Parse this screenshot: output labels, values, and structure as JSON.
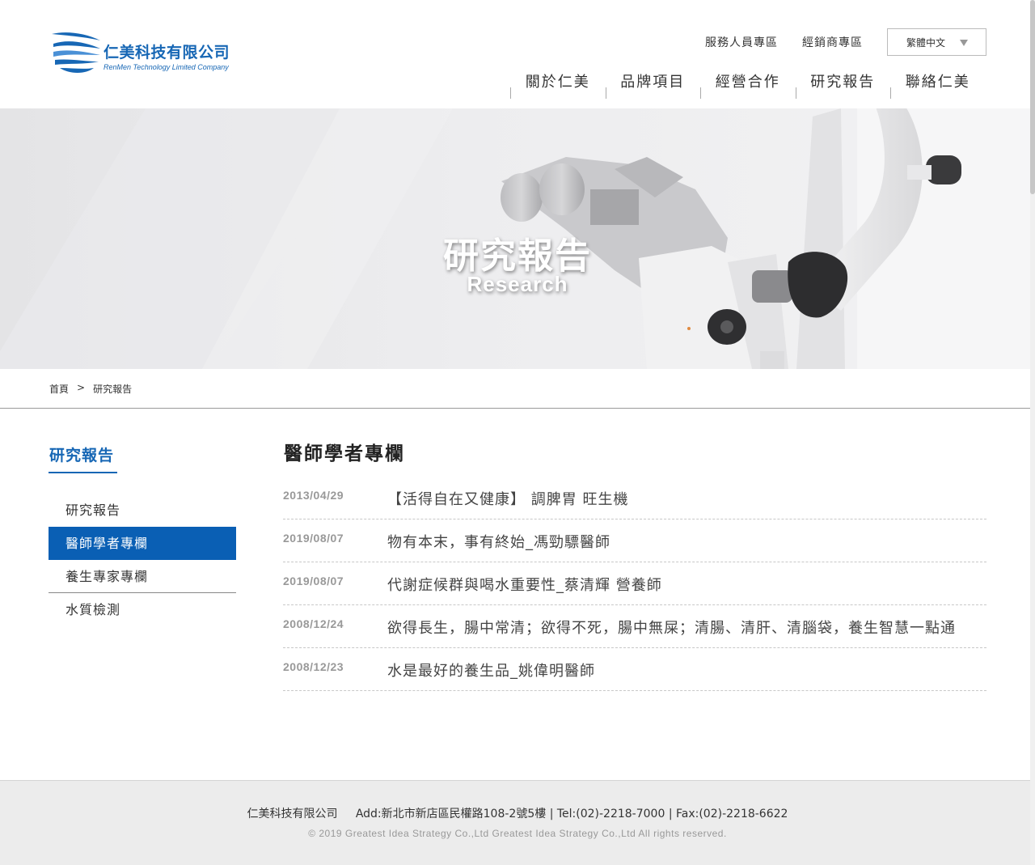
{
  "header": {
    "logo_name": "仁美科技有限公司",
    "logo_sub": "RenMen Technology Limited Company",
    "top_links": [
      "服務人員專區",
      "經銷商專區"
    ],
    "language": "繁體中文",
    "nav": [
      "關於仁美",
      "品牌項目",
      "經營合作",
      "研究報告",
      "聯絡仁美"
    ]
  },
  "banner": {
    "title": "研究報告",
    "subtitle": "Research"
  },
  "breadcrumb": {
    "home": "首頁",
    "separator": ">",
    "current": "研究報告"
  },
  "sidebar": {
    "title": "研究報告",
    "items": [
      "研究報告",
      "醫師學者專欄",
      "養生專家專欄",
      "水質檢測"
    ],
    "active_index": 1
  },
  "content": {
    "title": "醫師學者專欄",
    "articles": [
      {
        "date": "2013/04/29",
        "title": "【活得自在又健康】 調脾胃 旺生機"
      },
      {
        "date": "2019/08/07",
        "title": "物有本末，事有終始_馮勁驃醫師"
      },
      {
        "date": "2019/08/07",
        "title": "代謝症候群與喝水重要性_蔡清輝 營養師"
      },
      {
        "date": "2008/12/24",
        "title": "欲得長生，腸中常清；欲得不死，腸中無屎；清腸、清肝、清腦袋，養生智慧一點通"
      },
      {
        "date": "2008/12/23",
        "title": "水是最好的養生品_姚偉明醫師"
      }
    ]
  },
  "footer": {
    "company": "仁美科技有限公司",
    "address": "Add:新北市新店區民權路108-2號5樓",
    "tel": "Tel:(02)-2218-7000",
    "fax": "Fax:(02)-2218-6622",
    "copyright": "© 2019 Greatest Idea Strategy Co.,Ltd Greatest Idea Strategy Co.,Ltd All rights reserved."
  },
  "colors": {
    "brand_blue": "#1767b5",
    "active_bg": "#0a5fb4"
  },
  "icons": {
    "logo": "wave-logo-icon",
    "dropdown": "triangle-down-icon"
  }
}
